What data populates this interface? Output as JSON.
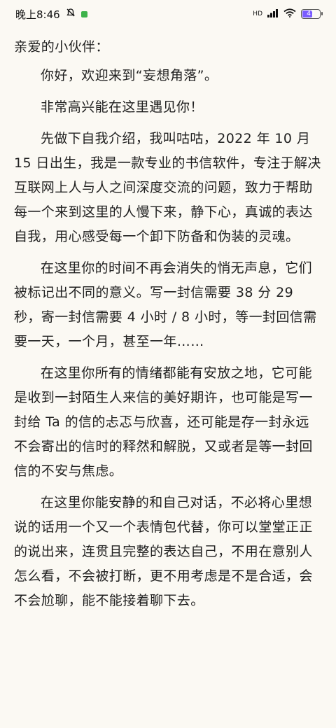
{
  "status_bar": {
    "time": "晚上8:46",
    "network_label": "HD",
    "battery_level": "47"
  },
  "letter": {
    "greeting": "亲爱的小伙伴：",
    "paragraphs": [
      "你好，欢迎来到“妄想角落”。",
      "非常高兴能在这里遇见你！",
      "先做下自我介绍，我叫咕咕，2022 年 10 月 15 日出生，我是一款专业的书信软件，专注于解决互联网上人与人之间深度交流的问题，致力于帮助每一个来到这里的人慢下来，静下心，真诚的表达自我，用心感受每一个卸下防备和伪装的灵魂。",
      "在这里你的时间不再会消失的悄无声息，它们被标记出不同的意义。写一封信需要 38 分 29 秒，寄一封信需要 4 小时 / 8 小时，等一封回信需要一天，一个月，甚至一年……",
      "在这里你所有的情绪都能有安放之地，它可能是收到一封陌生人来信的美好期许，也可能是写一封给 Ta 的信的忐忑与欣喜，还可能是存一封永远不会寄出的信时的释然和解脱，又或者是等一封回信的不安与焦虑。",
      "在这里你能安静的和自己对话，不必将心里想说的话用一个又一个表情包代替，你可以堂堂正正的说出来，连贯且完整的表达自己，不用在意别人怎么看，不会被打断，更不用考虑是不是合适，会不会尬聊，能不能接着聊下去。"
    ]
  }
}
